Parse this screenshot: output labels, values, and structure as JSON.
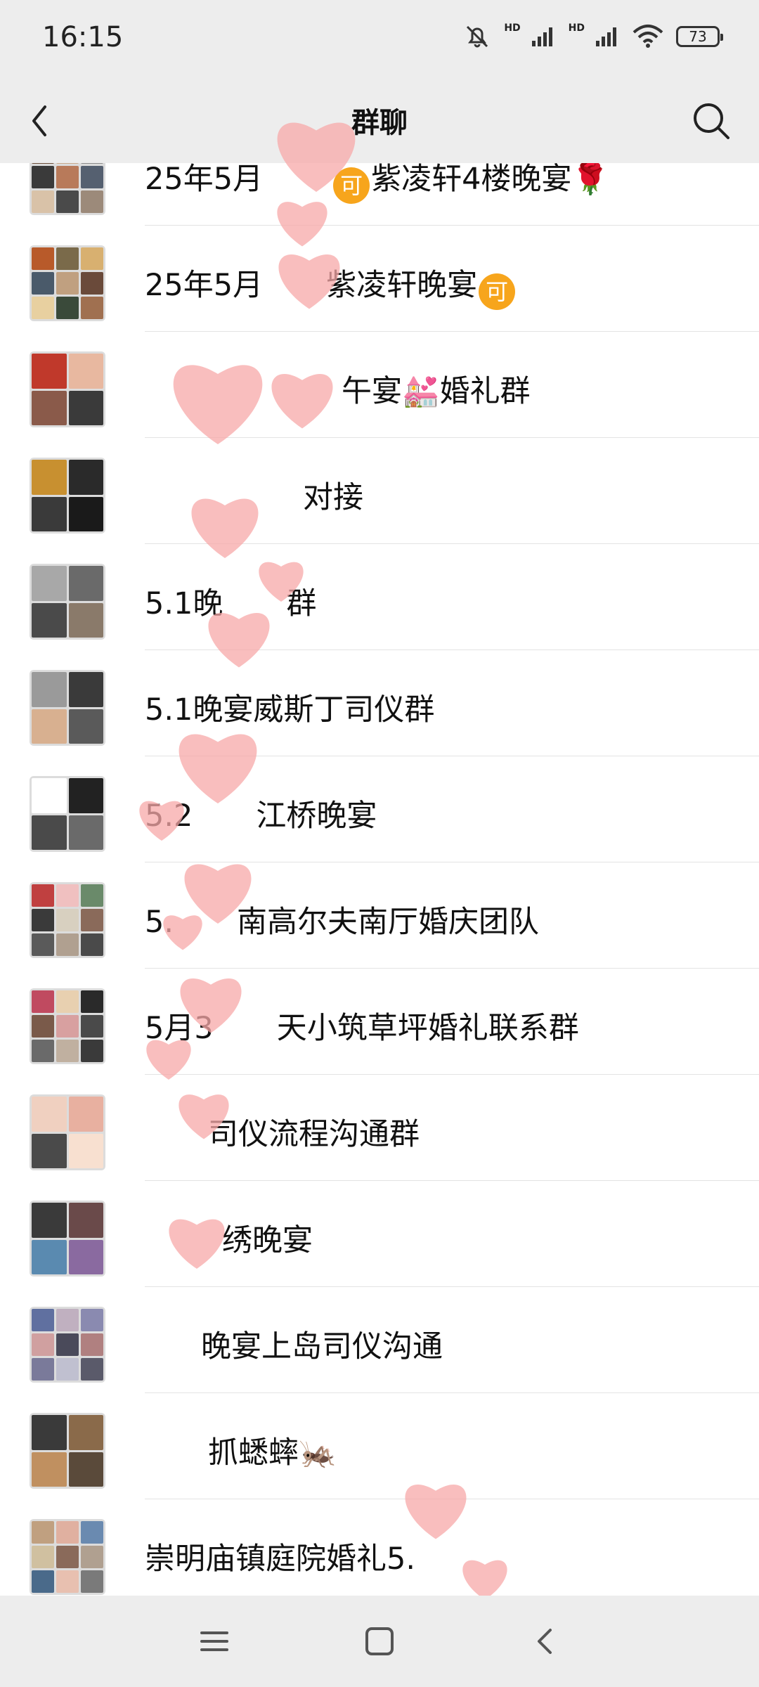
{
  "status_bar": {
    "time": "16:15",
    "hd1": "HD",
    "hd2": "HD",
    "battery": "73",
    "icons": [
      "mute-bell-icon",
      "signal-icon",
      "signal-icon",
      "wifi-icon",
      "battery-icon"
    ]
  },
  "header": {
    "title": "群聊",
    "back_icon": "chevron-left-icon",
    "search_icon": "search-icon"
  },
  "groups": [
    {
      "name_pre": "25年5月",
      "coin": "可",
      "name_post": "紫凌轩4楼晚宴🌹",
      "coin_pos": "mid"
    },
    {
      "name_pre": "25年5月",
      "coin": "",
      "name_post": "紫凌轩晚宴",
      "coin_after": "可"
    },
    {
      "name_pre": "",
      "coin": "",
      "name_post": "午宴💒婚礼群"
    },
    {
      "name_pre": "",
      "coin": "",
      "name_post": "对接"
    },
    {
      "name_pre": "5.1晚",
      "coin": "",
      "name_post": "群"
    },
    {
      "name_pre": "5.1晚宴威斯丁司仪群",
      "coin": "",
      "name_post": ""
    },
    {
      "name_pre": "5.2",
      "coin": "",
      "name_post": "江桥晚宴"
    },
    {
      "name_pre": "5.",
      "coin": "",
      "name_post": "南高尔夫南厅婚庆团队"
    },
    {
      "name_pre": "5月3",
      "coin": "",
      "name_post": "天小筑草坪婚礼联系群"
    },
    {
      "name_pre": "",
      "coin": "",
      "name_post": "司仪流程沟通群"
    },
    {
      "name_pre": "",
      "coin": "",
      "name_post": "绣晚宴"
    },
    {
      "name_pre": "",
      "coin": "",
      "name_post": "晚宴上岛司仪沟通"
    },
    {
      "name_pre": "",
      "coin": "",
      "name_post": "抓蟋蟀🦗"
    },
    {
      "name_pre": "崇明庙镇庭院婚礼5.",
      "coin": "",
      "name_post": ""
    }
  ],
  "system_nav": {
    "menu_icon": "menu-icon",
    "home_icon": "square-home-icon",
    "back_icon": "back-triangle-icon"
  },
  "colors": {
    "bar_bg": "#ededed",
    "coin": "#f7a51c",
    "heart": "#f7a8a8"
  }
}
